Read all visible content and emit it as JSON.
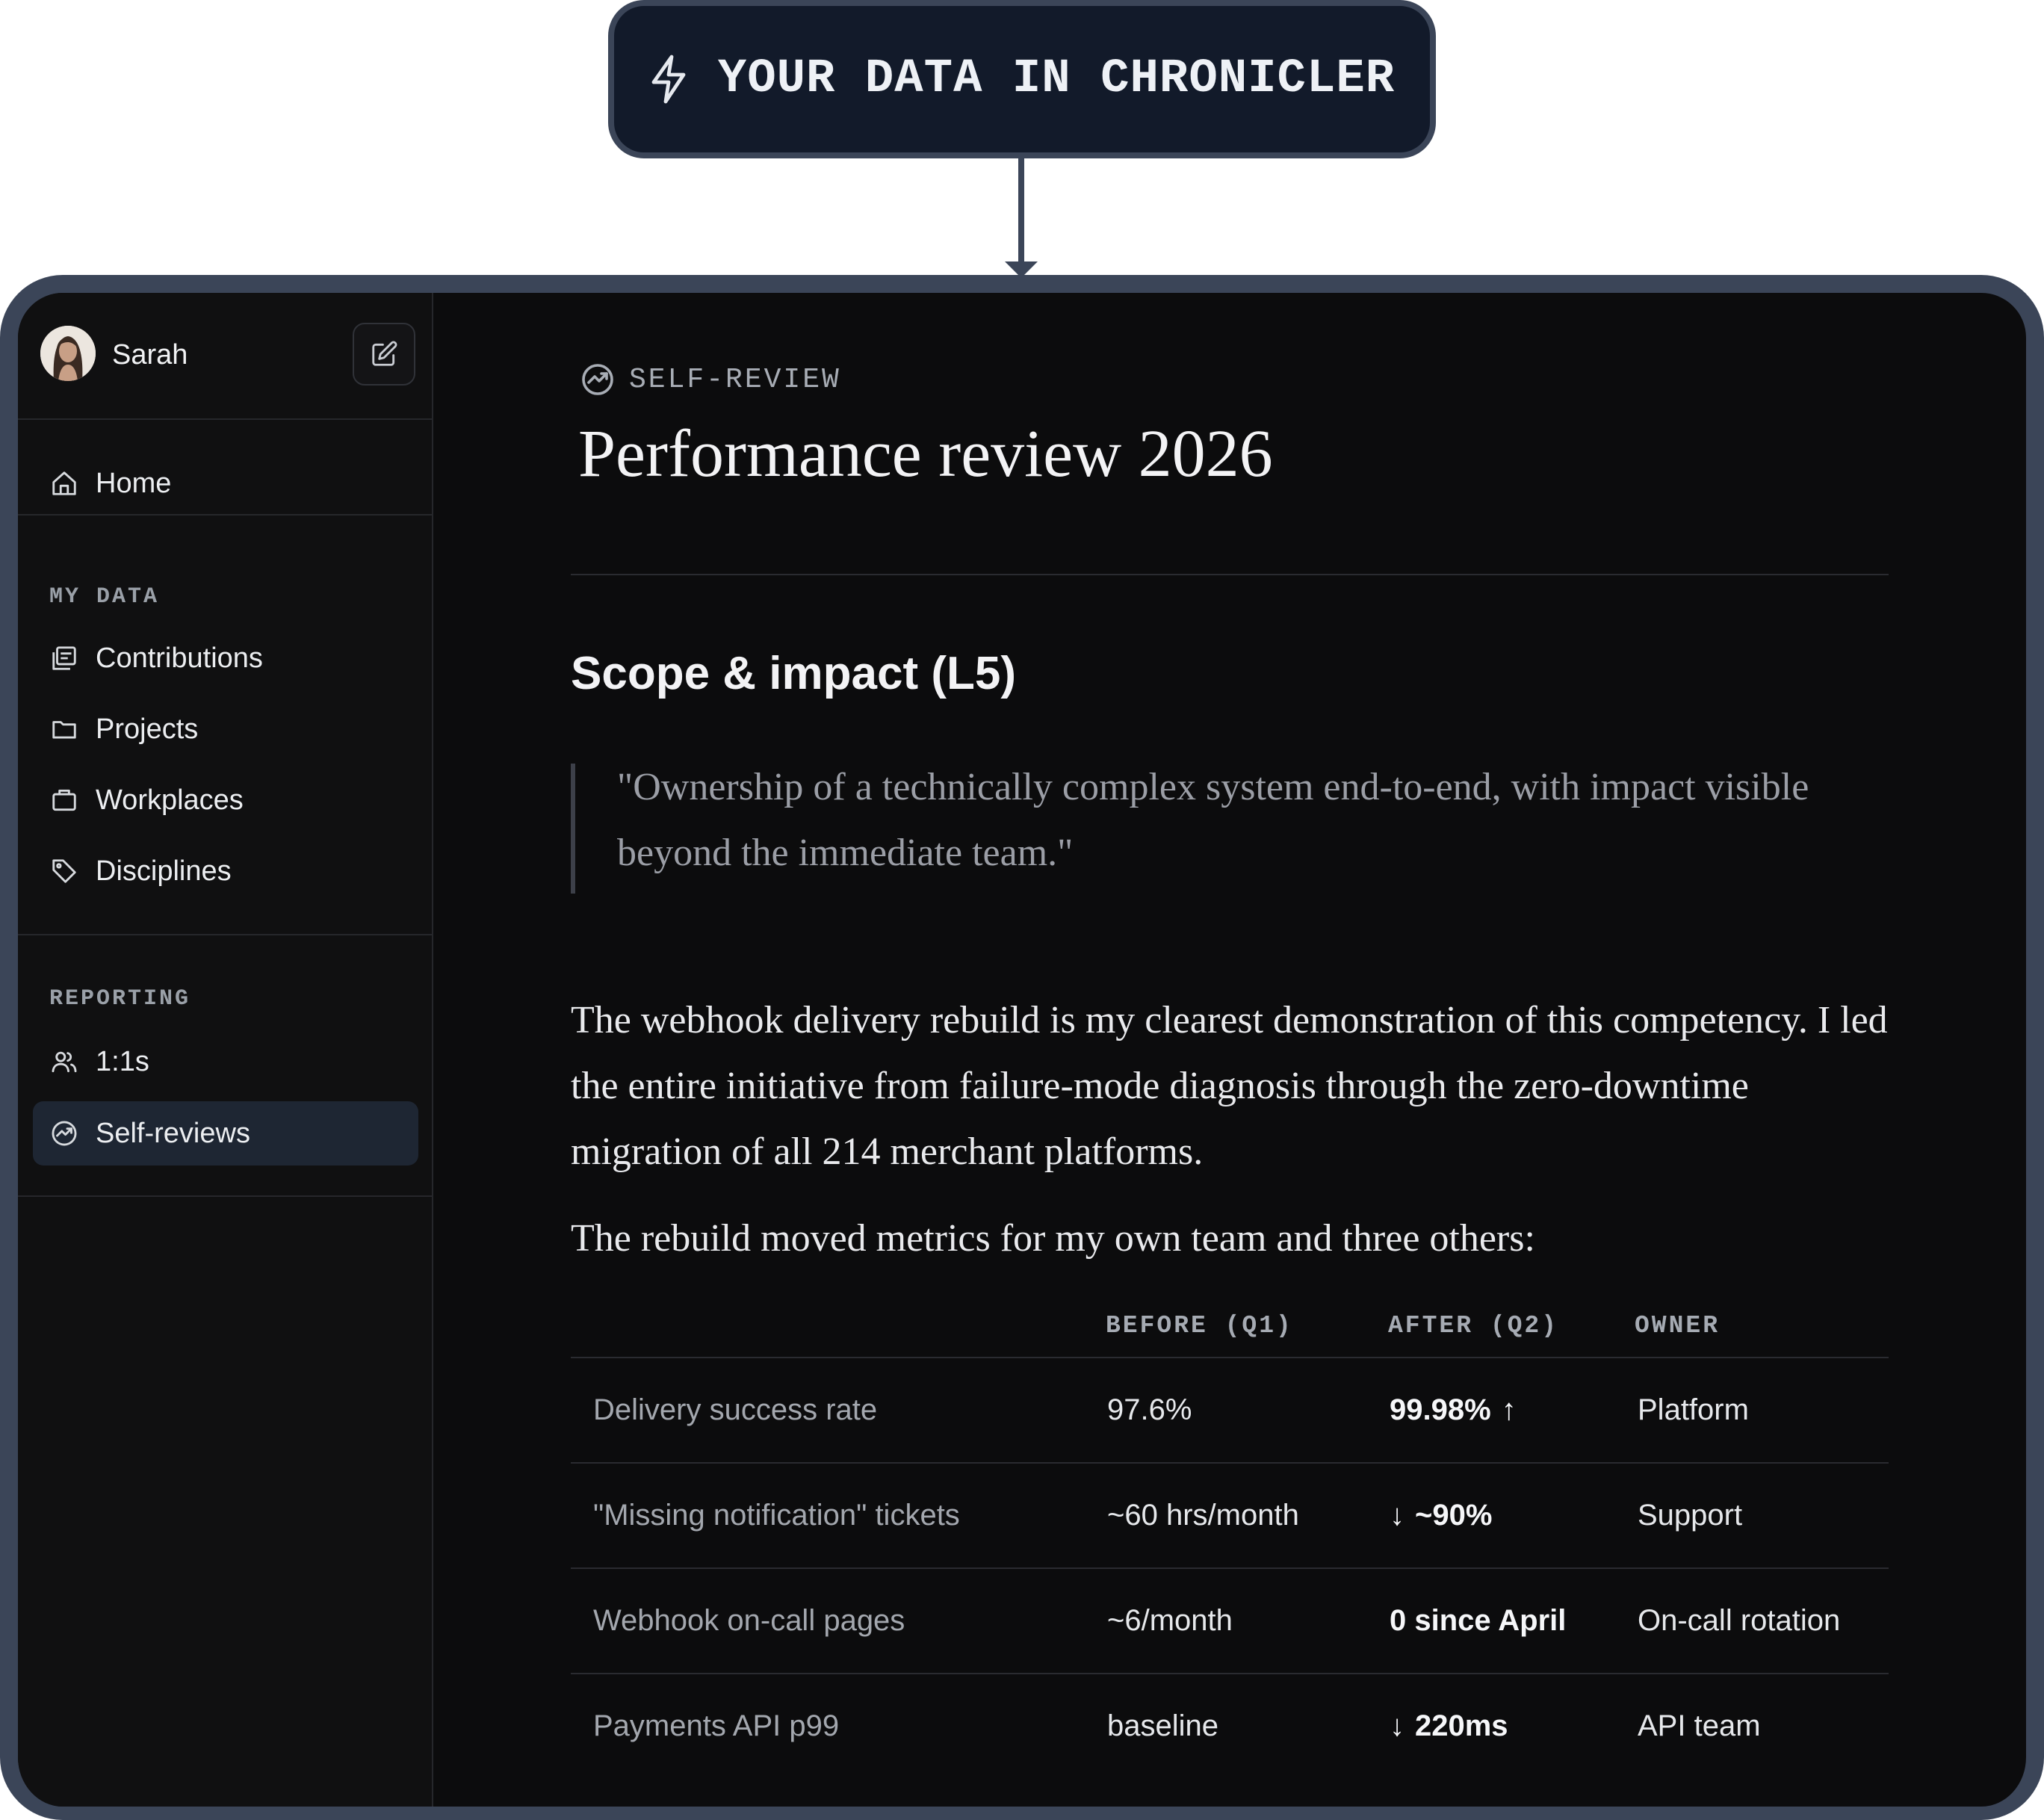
{
  "callout": {
    "icon": "lightning-icon",
    "text": "YOUR DATA IN CHRONICLER"
  },
  "sidebar": {
    "user": {
      "name": "Sarah",
      "avatar": "avatar"
    },
    "edit_icon": "edit-icon",
    "home": {
      "label": "Home",
      "icon": "home-icon"
    },
    "sections": [
      {
        "label": "MY DATA",
        "items": [
          {
            "label": "Contributions",
            "icon": "contributions-icon"
          },
          {
            "label": "Projects",
            "icon": "folder-icon"
          },
          {
            "label": "Workplaces",
            "icon": "briefcase-icon"
          },
          {
            "label": "Disciplines",
            "icon": "tag-icon"
          }
        ]
      },
      {
        "label": "REPORTING",
        "items": [
          {
            "label": "1:1s",
            "icon": "people-icon"
          },
          {
            "label": "Self-reviews",
            "icon": "review-icon",
            "active": true
          }
        ]
      }
    ]
  },
  "main": {
    "kicker": "SELF-REVIEW",
    "title": "Performance review 2026",
    "section_heading": "Scope & impact (L5)",
    "quote": "\"Ownership of a technically complex system end-to-end, with impact visible beyond the immediate team.\"",
    "paragraphs": [
      "The webhook delivery rebuild is my clearest demonstration of this competency. I led the entire initiative from failure-mode diagnosis through the zero-downtime migration of all 214 merchant platforms.",
      "The rebuild moved metrics for my own team and three others:"
    ],
    "table": {
      "headers": [
        "",
        "BEFORE (Q1)",
        "AFTER (Q2)",
        "OWNER"
      ],
      "rows": [
        {
          "metric": "Delivery success rate",
          "before": "97.6%",
          "after": "99.98%",
          "after_arrow": "↑",
          "arrow_position": "after",
          "owner": "Platform"
        },
        {
          "metric": "\"Missing notification\" tickets",
          "before": "~60 hrs/month",
          "after": "~90%",
          "after_arrow": "↓",
          "arrow_position": "before",
          "owner": "Support"
        },
        {
          "metric": "Webhook on-call pages",
          "before": "~6/month",
          "after": "0 since April",
          "after_arrow": "",
          "arrow_position": "none",
          "owner": "On-call rotation"
        },
        {
          "metric": "Payments API p99",
          "before": "baseline",
          "after": "220ms",
          "after_arrow": "↓",
          "arrow_position": "before",
          "owner": "API team"
        }
      ]
    }
  },
  "colors": {
    "background": "#0c0c0d",
    "sidebar": "#101011",
    "frame": "#3b4558",
    "callout_bg": "#121a2a",
    "active_item": "#1e2633"
  }
}
